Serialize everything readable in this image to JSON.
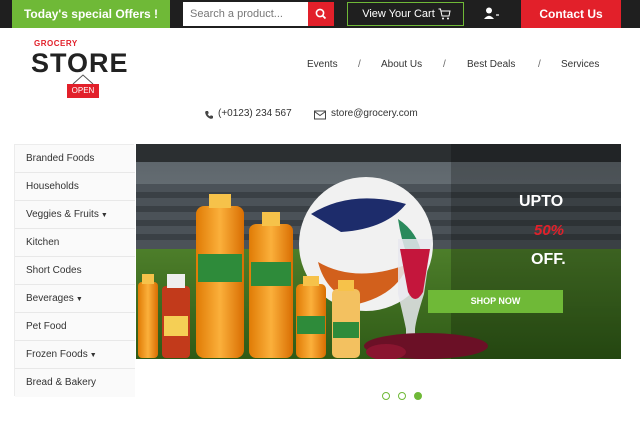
{
  "topbar": {
    "offers_label": "Today's special Offers !",
    "search_placeholder": "Search a product...",
    "cart_label": "View Your Cart",
    "contact_label": "Contact Us"
  },
  "logo": {
    "small": "GROCERY",
    "big": "STORE",
    "sign": "OPEN"
  },
  "nav": [
    "Events",
    "About Us",
    "Best Deals",
    "Services"
  ],
  "nav_separator": "/",
  "contact": {
    "phone": "(+0123) 234 567",
    "email": "store@grocery.com"
  },
  "sidebar": [
    "Branded Foods",
    "Households",
    "Veggies & Fruits",
    "Kitchen",
    "Short Codes",
    "Beverages",
    "Pet Food",
    "Frozen Foods",
    "Bread & Bakery"
  ],
  "banner": {
    "line1": "UPTO",
    "line2": "50%",
    "line3": "OFF.",
    "button": "SHOP NOW"
  },
  "slider": {
    "count": 3,
    "active": 3
  },
  "colors": {
    "green": "#6fb937",
    "red": "#e2202a",
    "dark": "#1f1f1f"
  }
}
